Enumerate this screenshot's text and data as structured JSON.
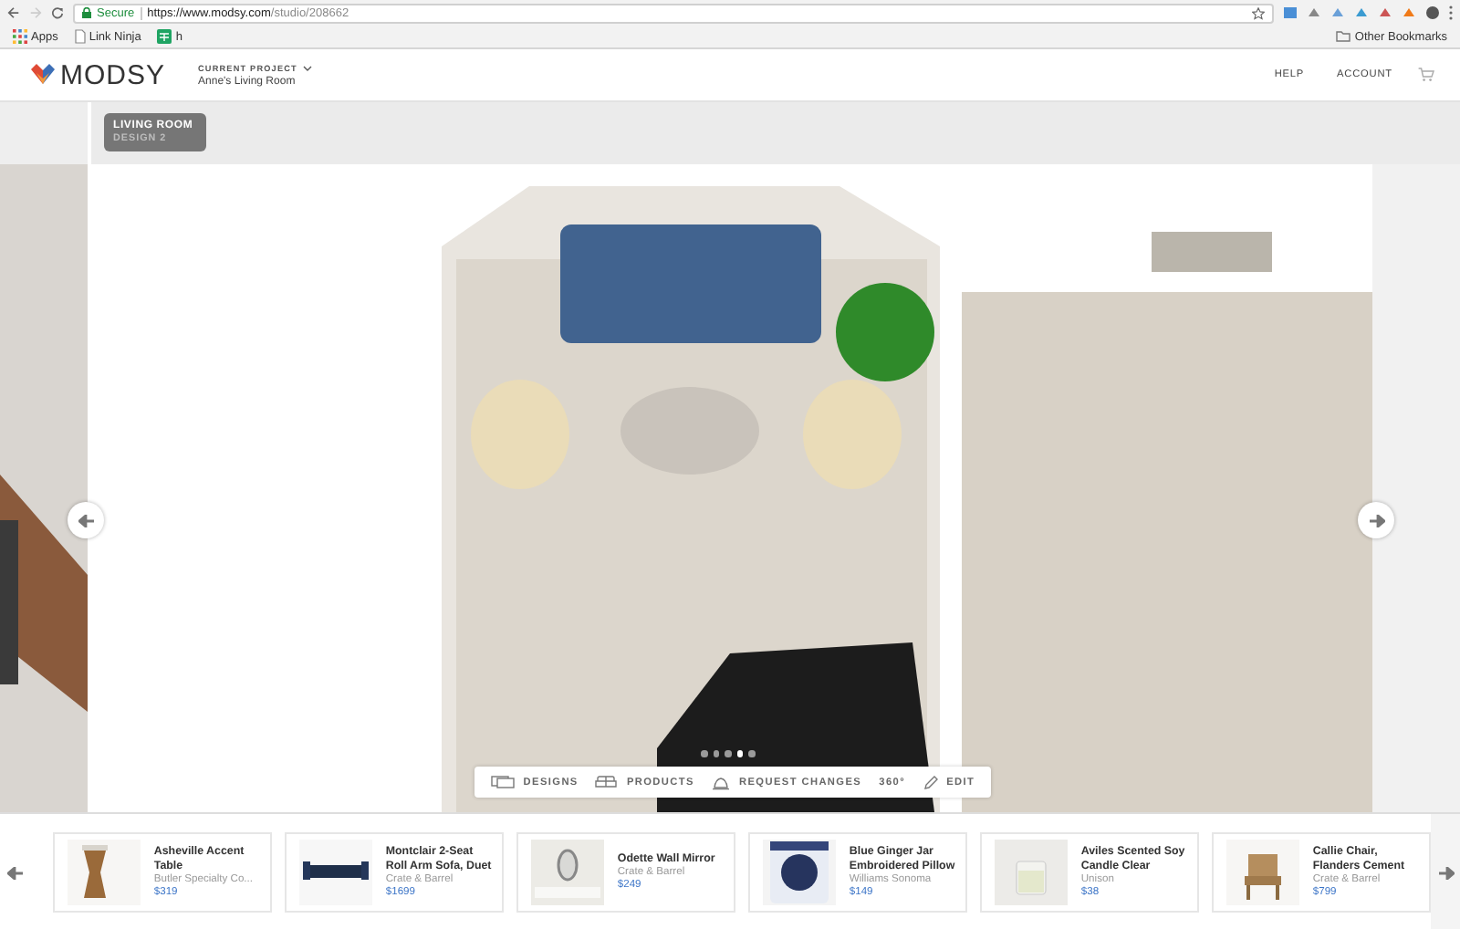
{
  "browser": {
    "secure_label": "Secure",
    "url_host": "https://www.modsy.com",
    "url_path": "/studio/208662",
    "bookmarks": [
      {
        "label": "Apps",
        "kind": "apps"
      },
      {
        "label": "Link Ninja",
        "kind": "page"
      },
      {
        "label": "h",
        "kind": "sheet"
      }
    ],
    "other_bookmarks": "Other Bookmarks"
  },
  "header": {
    "brand": "MODSY",
    "project_label": "CURRENT PROJECT",
    "project_name": "Anne's Living Room",
    "nav": [
      "HELP",
      "ACCOUNT"
    ]
  },
  "room_badge": {
    "title": "LIVING ROOM",
    "subtitle": "DESIGN 2"
  },
  "view": {
    "kind": "picture",
    "slides": [
      {
        "selected": false
      },
      {
        "selected": false
      },
      {
        "selected": false
      },
      {
        "selected": true
      },
      {
        "selected": false
      }
    ]
  },
  "toolbar": [
    {
      "label": "DESIGNS"
    },
    {
      "label": "PRODUCTS"
    },
    {
      "label": "REQUEST CHANGES"
    },
    {
      "label": "360°"
    },
    {
      "label": "EDIT"
    }
  ],
  "products": [
    {
      "name": "Asheville Accent Table",
      "vendor": "Butler Specialty Co...",
      "price": "$319"
    },
    {
      "name": "Montclair 2-Seat Roll Arm Sofa, Duet",
      "vendor": "Crate & Barrel",
      "price": "$1699"
    },
    {
      "name": "Odette Wall Mirror",
      "vendor": "Crate & Barrel",
      "price": "$249"
    },
    {
      "name": "Blue Ginger Jar Embroidered Pillow",
      "vendor": "Williams Sonoma",
      "price": "$149"
    },
    {
      "name": "Aviles Scented Soy Candle Clear",
      "vendor": "Unison",
      "price": "$38"
    },
    {
      "name": "Callie Chair, Flanders Cement",
      "vendor": "Crate & Barrel",
      "price": "$799"
    }
  ]
}
